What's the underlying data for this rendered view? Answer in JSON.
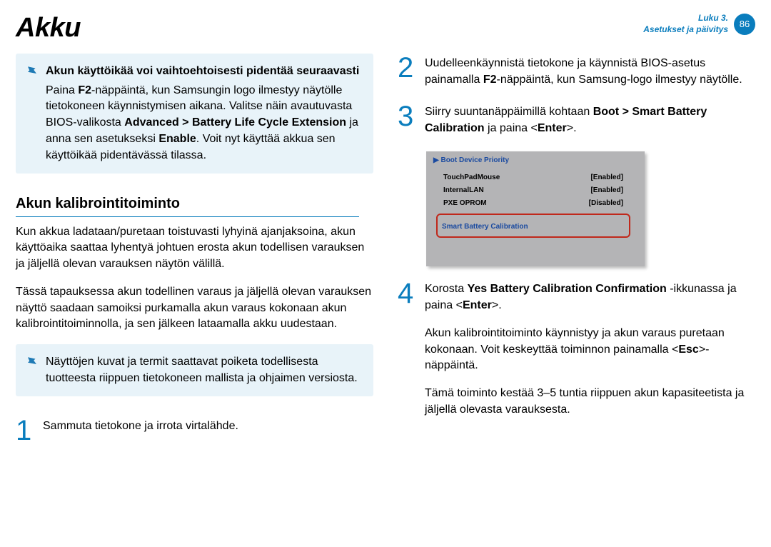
{
  "header": {
    "title": "Akku",
    "chapter": "Luku 3.",
    "section": "Asetukset ja päivitys",
    "page": "86"
  },
  "left": {
    "note1": {
      "title": "Akun käyttöikää voi vaihtoehtoisesti pidentää seuraavasti",
      "body_a": "Paina ",
      "body_b": "-näppäintä, kun Samsungin logo ilmestyy näytölle tietokoneen käynnistymisen aikana. Valitse näin avautuvasta BIOS-valikosta ",
      "bold1": "F2",
      "bold2": "Advanced > Battery Life Cycle Extension",
      "body_c": " ja anna sen asetukseksi ",
      "bold3": "Enable",
      "body_d": ". Voit nyt käyttää akkua sen käyttöikää pidentävässä tilassa."
    },
    "heading": "Akun kalibrointitoiminto",
    "p1": "Kun akkua ladataan/puretaan toistuvasti lyhyinä ajanjaksoina, akun käyttöaika saattaa lyhentyä johtuen erosta akun todellisen varauksen ja jäljellä olevan varauksen näytön välillä.",
    "p2": "Tässä tapauksessa akun todellinen varaus ja jäljellä olevan varauksen näyttö saadaan samoiksi purkamalla akun varaus kokonaan akun kalibrointitoiminnolla, ja sen jälkeen lataamalla akku uudestaan.",
    "note2": "Näyttöjen kuvat ja termit saattavat poiketa todellisesta tuotteesta riippuen tietokoneen mallista ja ohjaimen versiosta.",
    "step1": "Sammuta tietokone ja irrota virtalähde."
  },
  "right": {
    "step2_a": "Uudelleenkäynnistä tietokone ja käynnistä BIOS-asetus painamalla ",
    "step2_bold": "F2",
    "step2_b": "-näppäintä, kun Samsung-logo ilmestyy näytölle.",
    "step3_a": "Siirry suuntanäppäimillä kohtaan ",
    "step3_bold1": "Boot > Smart Battery Calibration",
    "step3_b": " ja paina <",
    "step3_bold2": "Enter",
    "step3_c": ">.",
    "bios": {
      "head": "▶ Boot Device Priority",
      "rows": [
        {
          "name": "TouchPadMouse",
          "val": "[Enabled]"
        },
        {
          "name": "InternalLAN",
          "val": "[Enabled]"
        },
        {
          "name": "PXE OPROM",
          "val": "[Disabled]"
        }
      ],
      "highlight": "Smart Battery Calibration"
    },
    "step4_a": "Korosta ",
    "step4_bold1": "Yes Battery Calibration Confirmation",
    "step4_b": " -ikkunassa ja paina <",
    "step4_bold2": "Enter",
    "step4_c": ">.",
    "step4_p2_a": "Akun kalibrointitoiminto käynnistyy ja akun varaus puretaan kokonaan. Voit keskeyttää toiminnon painamalla <",
    "step4_p2_bold": "Esc",
    "step4_p2_b": ">-näppäintä.",
    "step4_p3": "Tämä toiminto kestää 3–5 tuntia riippuen akun kapasiteetista ja jäljellä olevasta varauksesta."
  }
}
